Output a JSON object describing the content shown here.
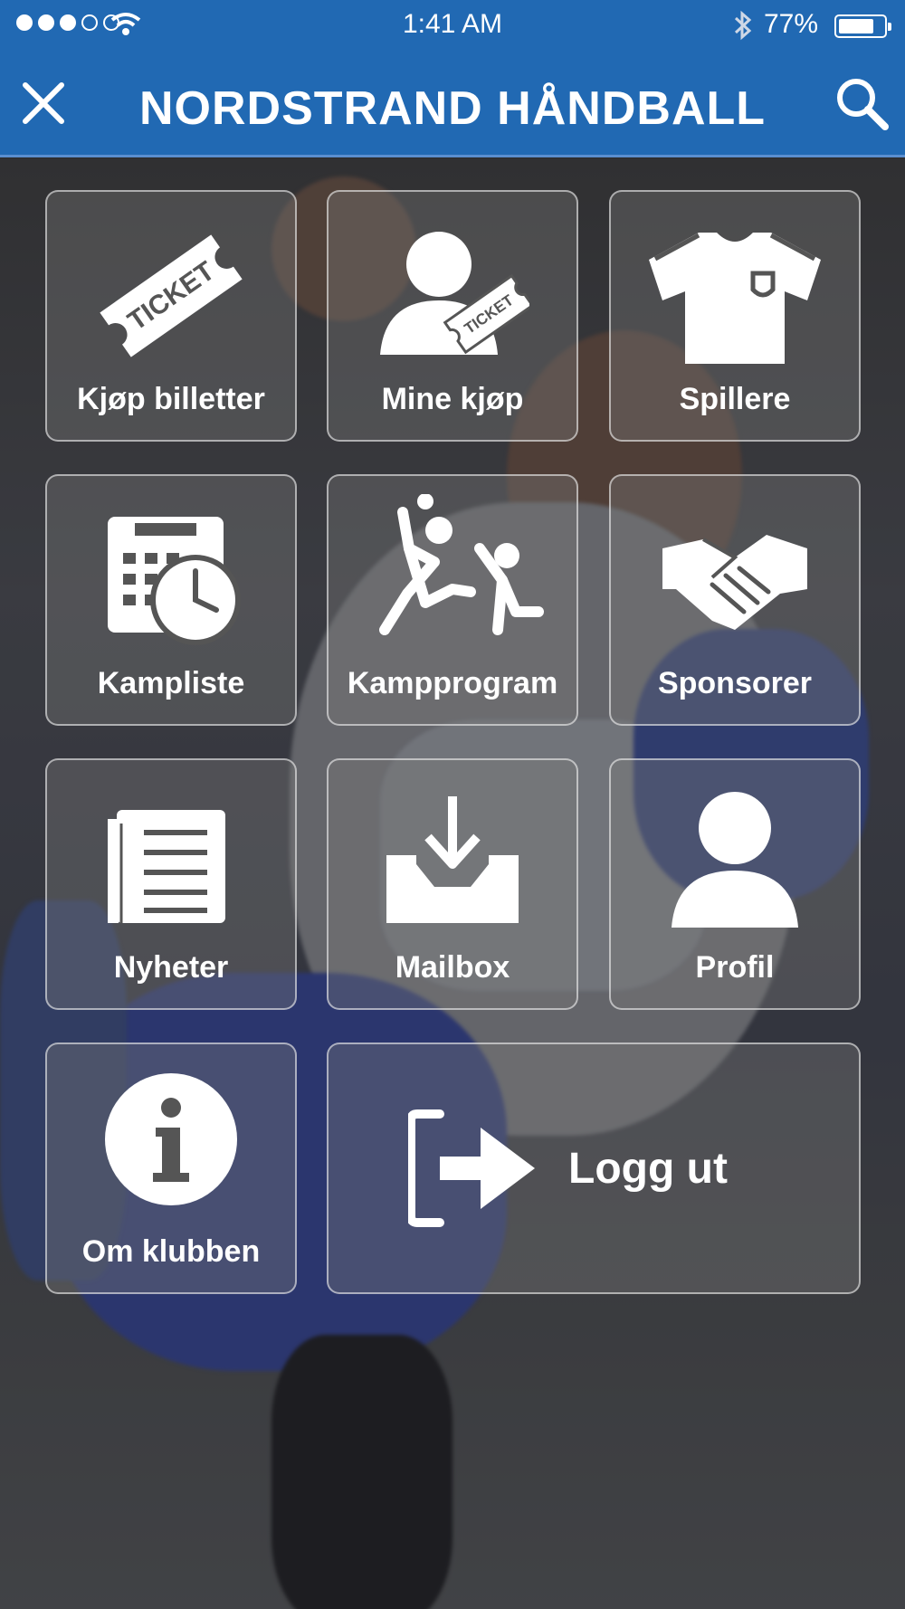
{
  "status_bar": {
    "time": "1:41 AM",
    "battery_percent": "77%",
    "battery_level": 0.77,
    "signal_bars_filled": 3,
    "signal_bars_total": 5
  },
  "navbar": {
    "title": "NORDSTRAND HÅNDBALL",
    "close_icon": "close-icon",
    "search_icon": "search-icon"
  },
  "menu": {
    "buy_tickets": "Kjøp billetter",
    "my_purchases": "Mine kjøp",
    "players": "Spillere",
    "match_list": "Kampliste",
    "match_program": "Kampprogram",
    "sponsors": "Sponsorer",
    "news": "Nyheter",
    "mailbox": "Mailbox",
    "profile": "Profil",
    "about_club": "Om klubben",
    "logout": "Logg ut"
  },
  "icons": {
    "ticket_text": "TICKET",
    "ticket_text_small": "TICKET"
  },
  "colors": {
    "brand_blue": "#2169b3"
  }
}
